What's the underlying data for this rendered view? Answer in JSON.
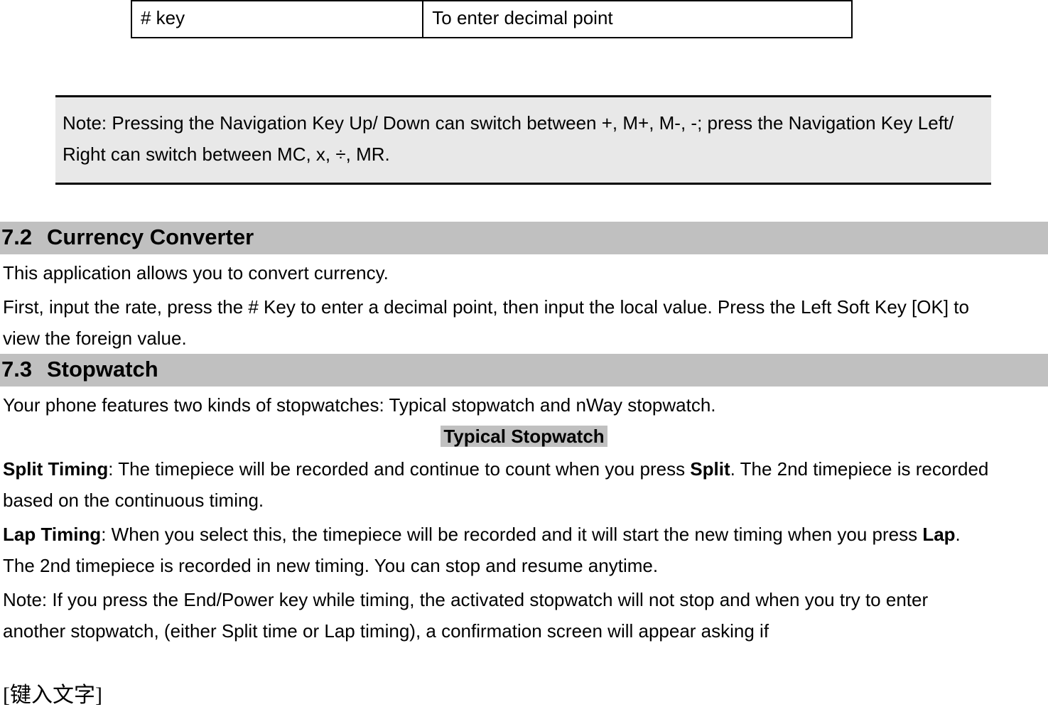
{
  "topTable": {
    "c1": "# key",
    "c2": "To enter decimal point"
  },
  "note": "Note: Pressing the Navigation Key Up/ Down can switch between +, M+, M-, -; press the Navigation Key Left/ Right can switch between MC, x, ÷, MR.",
  "section72": {
    "num": "7.2",
    "title": "Currency Converter",
    "p1": "This application allows you to convert currency.",
    "p2": "First, input the rate, press the # Key to enter a decimal point, then input the local value. Press the Left Soft Key [OK] to view the foreign value."
  },
  "section73": {
    "num": "7.3",
    "title": "Stopwatch",
    "intro": "Your phone features two kinds of stopwatches: Typical stopwatch and nWay stopwatch.",
    "sub": "Typical Stopwatch",
    "split_label": "Split Timing",
    "split_t1": ": The timepiece will be recorded and continue to count when you press ",
    "split_bold": "Split",
    "split_t2": ". The 2nd timepiece is recorded based on the continuous timing.",
    "lap_label": "Lap Timing",
    "lap_t1": ": When you select this, the timepiece will be recorded and it will start the new timing when you press ",
    "lap_bold": "Lap",
    "lap_t2": ". The 2nd timepiece is recorded in new timing. You can stop and resume anytime.",
    "note2": "Note: If you press the End/Power key while timing, the activated stopwatch will not stop and when you try to enter another stopwatch, (either Split time or Lap timing), a confirmation screen will appear asking if"
  },
  "footer": "[键入文字]"
}
